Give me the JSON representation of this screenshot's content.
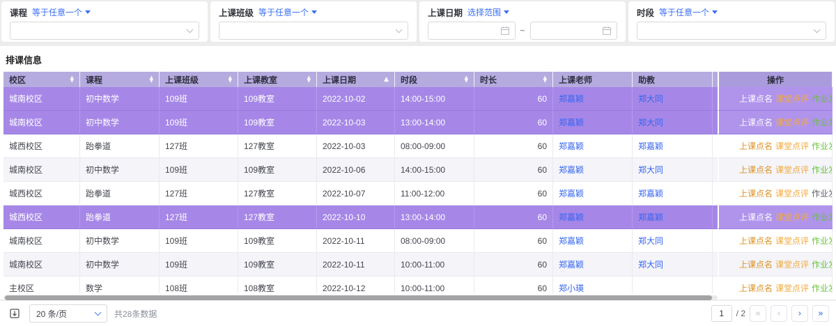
{
  "filters": [
    {
      "label": "课程",
      "mode": "等于任意一个"
    },
    {
      "label": "上课班级",
      "mode": "等于任意一个"
    },
    {
      "label": "上课日期",
      "mode": "选择范围",
      "separator": "~"
    },
    {
      "label": "时段",
      "mode": "等于任意一个"
    }
  ],
  "section": {
    "title": "排课信息"
  },
  "table": {
    "columns": [
      {
        "label": "校区",
        "sortable": true
      },
      {
        "label": "课程",
        "sortable": true
      },
      {
        "label": "上课班级",
        "sortable": true
      },
      {
        "label": "上课教室",
        "sortable": true
      },
      {
        "label": "上课日期",
        "sortable": true,
        "sorted": "asc"
      },
      {
        "label": "时段",
        "sortable": true
      },
      {
        "label": "时长",
        "sortable": true,
        "align": "right"
      },
      {
        "label": "上课老师",
        "link": true
      },
      {
        "label": "助教",
        "link": true
      }
    ],
    "ops": {
      "header": "操作",
      "actions": [
        "上课点名",
        "课堂点评",
        "作业发布"
      ]
    },
    "rows": [
      {
        "cells": [
          "城南校区",
          "初中数学",
          "109班",
          "109教室",
          "2022-10-02",
          "14:00-15:00",
          "60",
          "郑嘉颖",
          "郑大同"
        ],
        "selected": true
      },
      {
        "cells": [
          "城南校区",
          "初中数学",
          "109班",
          "109教室",
          "2022-10-03",
          "13:00-14:00",
          "60",
          "郑嘉颖",
          "郑大同"
        ],
        "selected": true
      },
      {
        "cells": [
          "城西校区",
          "跆拳道",
          "127班",
          "127教室",
          "2022-10-03",
          "08:00-09:00",
          "60",
          "郑嘉颖",
          "郑嘉颖"
        ]
      },
      {
        "cells": [
          "城南校区",
          "初中数学",
          "109班",
          "109教室",
          "2022-10-06",
          "14:00-15:00",
          "60",
          "郑嘉颖",
          "郑大同"
        ]
      },
      {
        "cells": [
          "城西校区",
          "跆拳道",
          "127班",
          "127教室",
          "2022-10-07",
          "11:00-12:00",
          "60",
          "郑嘉颖",
          "郑嘉颖"
        ],
        "ops_muted": [
          2
        ]
      },
      {
        "cells": [
          "城西校区",
          "跆拳道",
          "127班",
          "127教室",
          "2022-10-10",
          "13:00-14:00",
          "60",
          "郑嘉颖",
          "郑嘉颖"
        ],
        "selected": true
      },
      {
        "cells": [
          "城南校区",
          "初中数学",
          "109班",
          "109教室",
          "2022-10-11",
          "08:00-09:00",
          "60",
          "郑嘉颖",
          "郑大同"
        ]
      },
      {
        "cells": [
          "城南校区",
          "初中数学",
          "109班",
          "109教室",
          "2022-10-11",
          "10:00-11:00",
          "60",
          "郑嘉颖",
          "郑大同"
        ]
      },
      {
        "cells": [
          "主校区",
          "数学",
          "108班",
          "108教室",
          "2022-10-12",
          "10:00-11:00",
          "60",
          "郑小瑛",
          ""
        ]
      }
    ]
  },
  "footer": {
    "page_size": "20 条/页",
    "total_text": "共28条数据",
    "current_page": "1",
    "page_suffix": "/ 2"
  },
  "colors": {
    "header_bg": "#b5abdf",
    "selected_bg": "#a687e7",
    "link_blue": "#3565f0",
    "op_orange": "#e6a23c",
    "op_green": "#67c23a"
  }
}
